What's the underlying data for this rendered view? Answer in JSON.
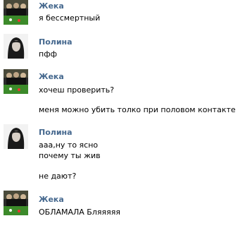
{
  "messages": [
    {
      "author": "Жека",
      "avatar_icon": "pool-table-avatar-icon",
      "lines": [
        "я бессмертный"
      ]
    },
    {
      "author": "Полина",
      "avatar_icon": "girl-portrait-avatar-icon",
      "lines": [
        "пфф"
      ]
    },
    {
      "author": "Жека",
      "avatar_icon": "pool-table-avatar-icon",
      "lines": [
        "хочеш проверить?",
        "меня можно убить толко при половом контакте"
      ]
    },
    {
      "author": "Полина",
      "avatar_icon": "girl-portrait-avatar-icon",
      "lines": [
        "ааа,ну то ясно",
        "почему ты жив",
        "не дают?"
      ]
    },
    {
      "author": "Жека",
      "avatar_icon": "pool-table-avatar-icon",
      "lines": [
        "ОБЛАМАЛА Бляяяяя"
      ]
    }
  ],
  "colors": {
    "author_name": "#45688e",
    "text": "#000000",
    "background": "#ffffff"
  }
}
